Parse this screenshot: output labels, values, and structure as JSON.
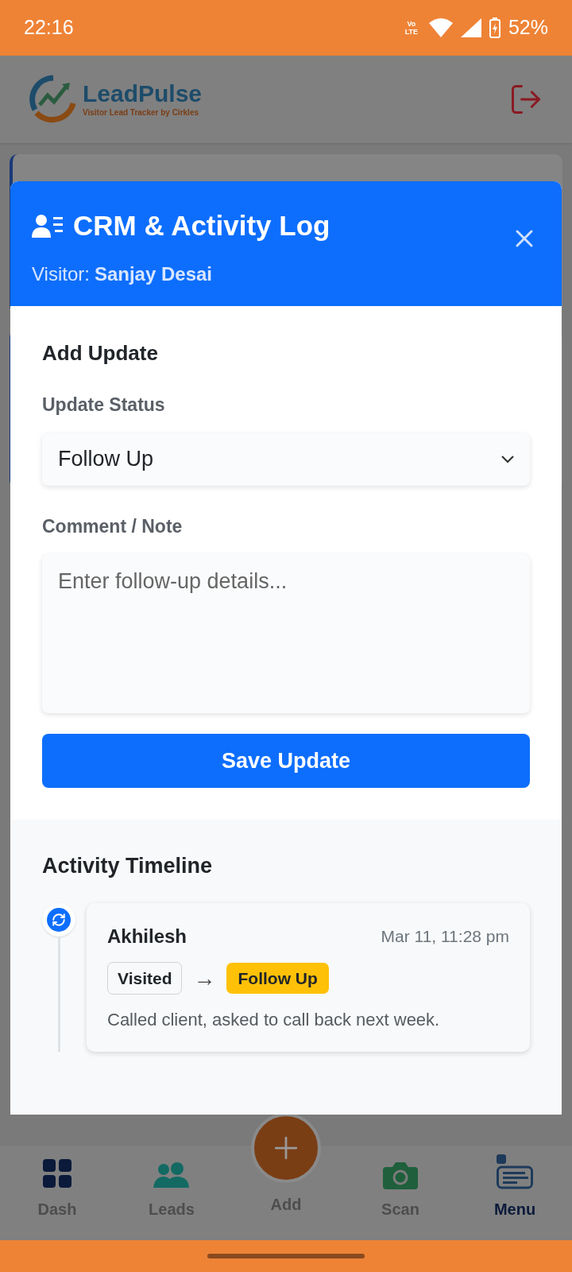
{
  "status_bar": {
    "time": "22:16",
    "network": "Vo LTE",
    "battery": "52%"
  },
  "app_header": {
    "brand": "LeadPulse",
    "tagline": "Visitor Lead Tracker by Cirkles"
  },
  "modal": {
    "title": "CRM & Activity Log",
    "visitor_label": "Visitor:",
    "visitor_name": "Sanjay Desai",
    "add_update": {
      "heading": "Add Update",
      "status_label": "Update Status",
      "status_value": "Follow Up",
      "comment_label": "Comment / Note",
      "comment_placeholder": "Enter follow-up details...",
      "save_button": "Save Update"
    },
    "timeline": {
      "heading": "Activity Timeline",
      "entries": [
        {
          "author": "Akhilesh",
          "time": "Mar 11, 11:28 pm",
          "from_status": "Visited",
          "arrow": "→",
          "to_status": "Follow Up",
          "color": "#ffc107",
          "note": "Called client, asked to call back next week."
        }
      ]
    }
  },
  "bottom_nav": [
    {
      "label": "Dash",
      "kind": "dash",
      "selected": false
    },
    {
      "label": "Leads",
      "kind": "leads",
      "selected": false
    },
    {
      "label": "Add",
      "kind": "add",
      "selected": false
    },
    {
      "label": "Scan",
      "kind": "scan",
      "selected": false
    },
    {
      "label": "Menu",
      "kind": "menu",
      "selected": true
    }
  ]
}
